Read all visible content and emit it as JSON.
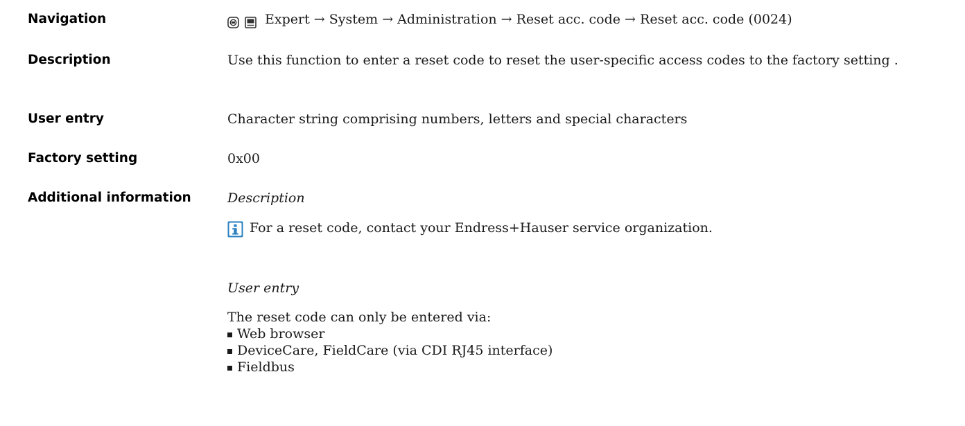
{
  "navigation": {
    "label": "Navigation",
    "icons": [
      "display-operation-icon",
      "display-module-icon"
    ],
    "path": "Expert → System → Administration → Reset acc. code → Reset acc. code (0024)"
  },
  "description": {
    "label": "Description",
    "text": "Use this function to enter a reset code to reset the user-specific access codes to the factory setting ."
  },
  "user_entry": {
    "label": "User entry",
    "text": "Character string comprising numbers, letters and special characters"
  },
  "factory_setting": {
    "label": "Factory setting",
    "value": "0x00"
  },
  "additional_information": {
    "label": "Additional information",
    "description_heading": "Description",
    "note": {
      "icon": "info-icon",
      "icon_color": "#2a7fc1",
      "text": "For a reset code, contact your Endress+Hauser service organization."
    },
    "user_entry_heading": "User entry",
    "user_entry_intro": "The reset code can only be entered via:",
    "user_entry_items": [
      "Web browser",
      "DeviceCare, FieldCare (via CDI RJ45 interface)",
      "Fieldbus"
    ]
  }
}
